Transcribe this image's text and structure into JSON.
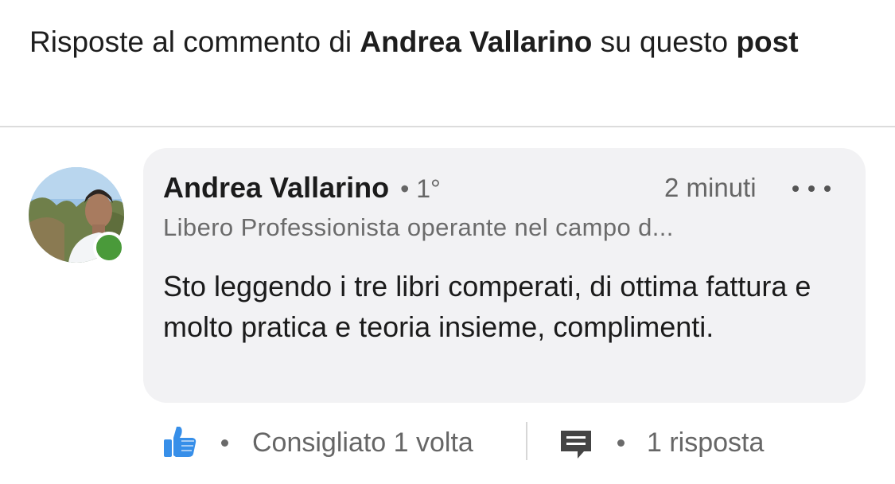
{
  "header": {
    "prefix": "Risposte al commento di ",
    "author": "Andrea Vallarino",
    "middle": " su questo ",
    "post_word": "post"
  },
  "comment": {
    "author_name": "Andrea Vallarino",
    "degree": "• 1°",
    "timestamp": "2 minuti",
    "headline": "Libero Professionista operante nel campo d...",
    "text": "Sto leggendo i tre libri comperati, di ottima fattura e molto pratica e teoria insieme, complimenti.",
    "presence": "online"
  },
  "actions": {
    "like_icon": "thumbs-up-icon",
    "like_count": "Consigliato 1 volta",
    "reply_icon": "comment-icon",
    "reply_count": "1 risposta"
  },
  "colors": {
    "bubble_bg": "#f2f2f4",
    "like_blue": "#378fe9",
    "presence_green": "#4a9a3a",
    "muted_text": "#666666"
  }
}
